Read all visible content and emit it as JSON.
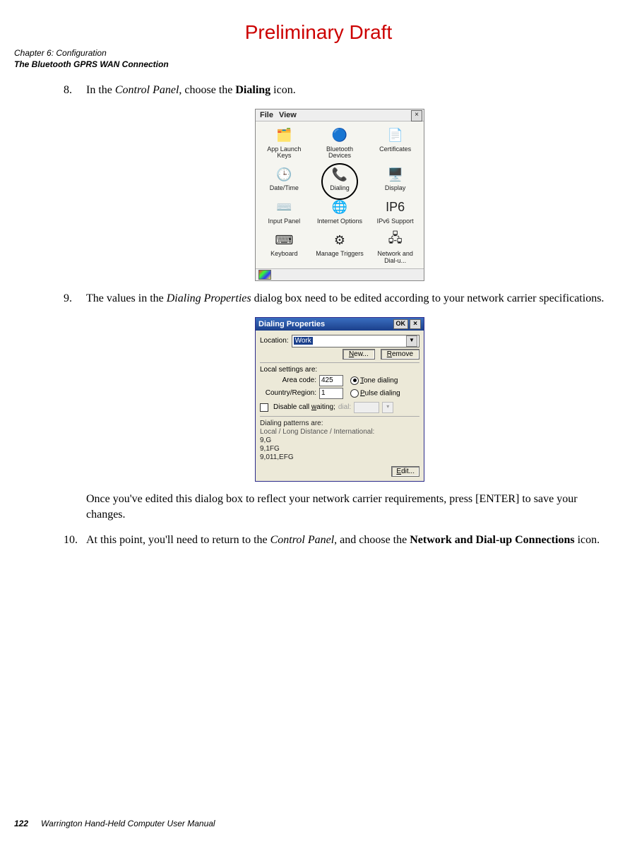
{
  "watermark": "Preliminary Draft",
  "chapter_line": "Chapter 6:  Configuration",
  "section_line": "The Bluetooth GPRS WAN Connection",
  "steps": {
    "s8": {
      "num": "8.",
      "pre": "In the ",
      "italic": "Control Panel",
      "mid": ", choose the ",
      "bold": "Dialing",
      "post": " icon."
    },
    "s9": {
      "num": "9.",
      "pre": "The values in the ",
      "italic": "Dialing Properties",
      "post": " dialog box need to be edited according to your network carrier specifications."
    },
    "s9b": "Once you've edited this dialog box to reflect your network carrier requirements, press [ENTER] to save your changes.",
    "s10": {
      "num": "10.",
      "pre": "At this point, you'll need to return to the ",
      "italic": "Control Panel",
      "mid": ", and choose the ",
      "bold": "Network and Dial-up Connections",
      "post": " icon."
    }
  },
  "cp": {
    "menu_file": "File",
    "menu_view": "View",
    "close": "×",
    "items": [
      {
        "label": "App Launch Keys",
        "icon": "🗂️"
      },
      {
        "label": "Bluetooth Devices",
        "icon": "🔵"
      },
      {
        "label": "Certificates",
        "icon": "📄"
      },
      {
        "label": "Date/Time",
        "icon": "🕒"
      },
      {
        "label": "Dialing",
        "icon": "📞",
        "circled": true
      },
      {
        "label": "Display",
        "icon": "🖥️"
      },
      {
        "label": "Input Panel",
        "icon": "⌨️"
      },
      {
        "label": "Internet Options",
        "icon": "🌐"
      },
      {
        "label": "IPv6 Support",
        "icon": "IP6"
      },
      {
        "label": "Keyboard",
        "icon": "⌨"
      },
      {
        "label": "Manage Triggers",
        "icon": "⚙"
      },
      {
        "label": "Network and Dial-u...",
        "icon": "🖧"
      }
    ]
  },
  "dp": {
    "title": "Dialing Properties",
    "ok": "OK",
    "close": "×",
    "location_label": "Location:",
    "location_value": "Work",
    "new_btn": "New...",
    "remove_btn": "Remove",
    "local_settings_label": "Local settings are:",
    "area_code_label": "Area code:",
    "area_code_value": "425",
    "country_label": "Country/Region:",
    "country_value": "1",
    "tone_label": "Tone dialing",
    "pulse_label": "Pulse dialing",
    "disable_cw_label": "Disable call waiting; dial:",
    "patterns_label": "Dialing patterns are:",
    "patterns_sub": "Local / Long Distance / International:",
    "patterns": [
      "9,G",
      "9,1FG",
      "9,011,EFG"
    ],
    "edit_btn": "Edit..."
  },
  "footer": {
    "page_num": "122",
    "text": "Warrington Hand-Held Computer User Manual"
  }
}
